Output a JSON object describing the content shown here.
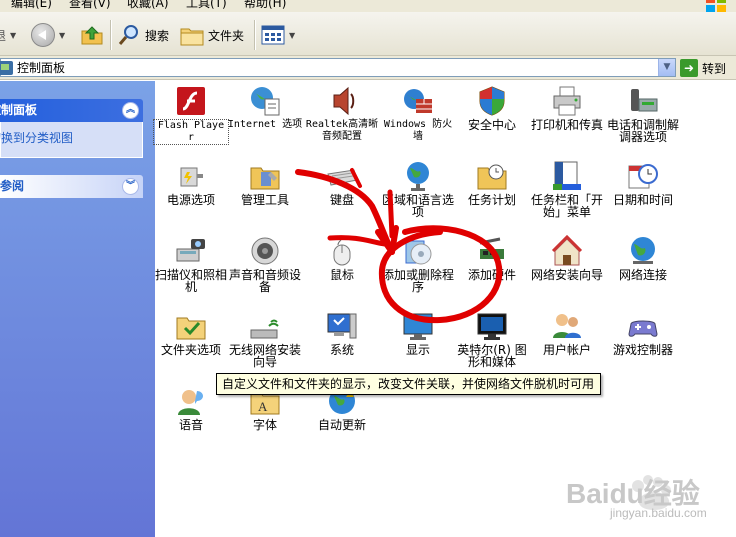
{
  "menu": {
    "items": [
      "编辑(E)",
      "查看(V)",
      "收藏(A)",
      "工具(T)",
      "帮助(H)"
    ]
  },
  "toolbar": {
    "back_fragment": "退",
    "search_label": "搜索",
    "folders_label": "文件夹"
  },
  "address": {
    "value": "控制面板",
    "go_label": "转到"
  },
  "taskpane": {
    "header1": "控制面板",
    "switch_link": "切换到分类视图",
    "header2": "另请参阅"
  },
  "items": [
    {
      "label": "Flash Player",
      "icon": "flash-icon"
    },
    {
      "label": "Internet 选项",
      "icon": "internet-options-icon"
    },
    {
      "label": "Realtek高清晰音频配置",
      "icon": "speaker-icon"
    },
    {
      "label": "Windows 防火墙",
      "icon": "firewall-icon"
    },
    {
      "label": "安全中心",
      "icon": "shield-icon"
    },
    {
      "label": "打印机和传真",
      "icon": "printer-icon"
    },
    {
      "label": "电话和调制解调器选项",
      "icon": "phone-icon"
    },
    {
      "label": "电源选项",
      "icon": "power-icon"
    },
    {
      "label": "管理工具",
      "icon": "admin-tools-icon"
    },
    {
      "label": "键盘",
      "icon": "keyboard-icon"
    },
    {
      "label": "区域和语言选项",
      "icon": "globe-icon"
    },
    {
      "label": "任务计划",
      "icon": "scheduled-tasks-icon"
    },
    {
      "label": "任务栏和「开始」菜单",
      "icon": "taskbar-icon"
    },
    {
      "label": "日期和时间",
      "icon": "clock-icon"
    },
    {
      "label": "扫描仪和照相机",
      "icon": "scanner-icon"
    },
    {
      "label": "声音和音频设备",
      "icon": "sound-icon"
    },
    {
      "label": "鼠标",
      "icon": "mouse-icon"
    },
    {
      "label": "添加或删除程序",
      "icon": "add-remove-programs-icon"
    },
    {
      "label": "添加硬件",
      "icon": "add-hardware-icon"
    },
    {
      "label": "网络安装向导",
      "icon": "network-setup-icon"
    },
    {
      "label": "网络连接",
      "icon": "network-connections-icon"
    },
    {
      "label": "文件夹选项",
      "icon": "folder-options-icon"
    },
    {
      "label": "无线网络安装向导",
      "icon": "wireless-icon"
    },
    {
      "label": "系统",
      "icon": "system-icon"
    },
    {
      "label": "显示",
      "icon": "display-icon"
    },
    {
      "label": "英特尔(R) 图形和媒体",
      "icon": "intel-graphics-icon"
    },
    {
      "label": "用户帐户",
      "icon": "users-icon"
    },
    {
      "label": "游戏控制器",
      "icon": "game-controller-icon"
    },
    {
      "label": "语音",
      "icon": "speech-icon"
    },
    {
      "label": "字体",
      "icon": "fonts-icon"
    },
    {
      "label": "自动更新",
      "icon": "auto-update-icon"
    }
  ],
  "tooltip": "自定义文件和文件夹的显示，改变文件关联，并使网络文件脱机时可用",
  "watermark": {
    "brand": "Baidu经验",
    "url": "jingyan.baidu.com"
  }
}
